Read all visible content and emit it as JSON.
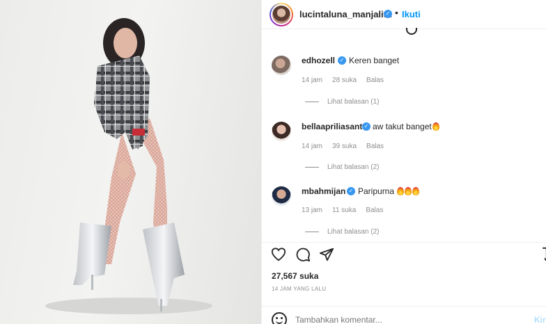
{
  "post": {
    "author": "lucintaluna_manjalita",
    "follow_label": "Ikuti",
    "likes": "27,567 suka",
    "time": "14 JAM YANG LALU",
    "comment_placeholder": "Tambahkan komentar...",
    "post_label": "Kirim"
  },
  "comments": [
    {
      "user": "edhozell",
      "text": "Keren banget",
      "time": "14 jam",
      "likes": "28 suka",
      "reply": "Balas",
      "view_replies": "Lihat balasan (1)"
    },
    {
      "user": "bellaapriliasant",
      "text": "aw takut banget",
      "time": "14 jam",
      "likes": "39 suka",
      "reply": "Balas",
      "view_replies": "Lihat balasan (2)"
    },
    {
      "user": "mbahmijan",
      "text": "Paripurna",
      "time": "13 jam",
      "likes": "11 suka",
      "reply": "Balas",
      "view_replies": "Lihat balasan (2)"
    }
  ],
  "icons": {
    "verified": "verified-badge-icon",
    "like": "heart-icon",
    "comment": "comment-bubble-icon",
    "share": "paper-plane-icon",
    "save": "bookmark-icon",
    "emoji": "emoji-icon",
    "flame": "fire-emoji-icon"
  },
  "colors": {
    "accent": "#0095f6",
    "verified": "#3897f0",
    "muted": "#8e8e8e"
  }
}
